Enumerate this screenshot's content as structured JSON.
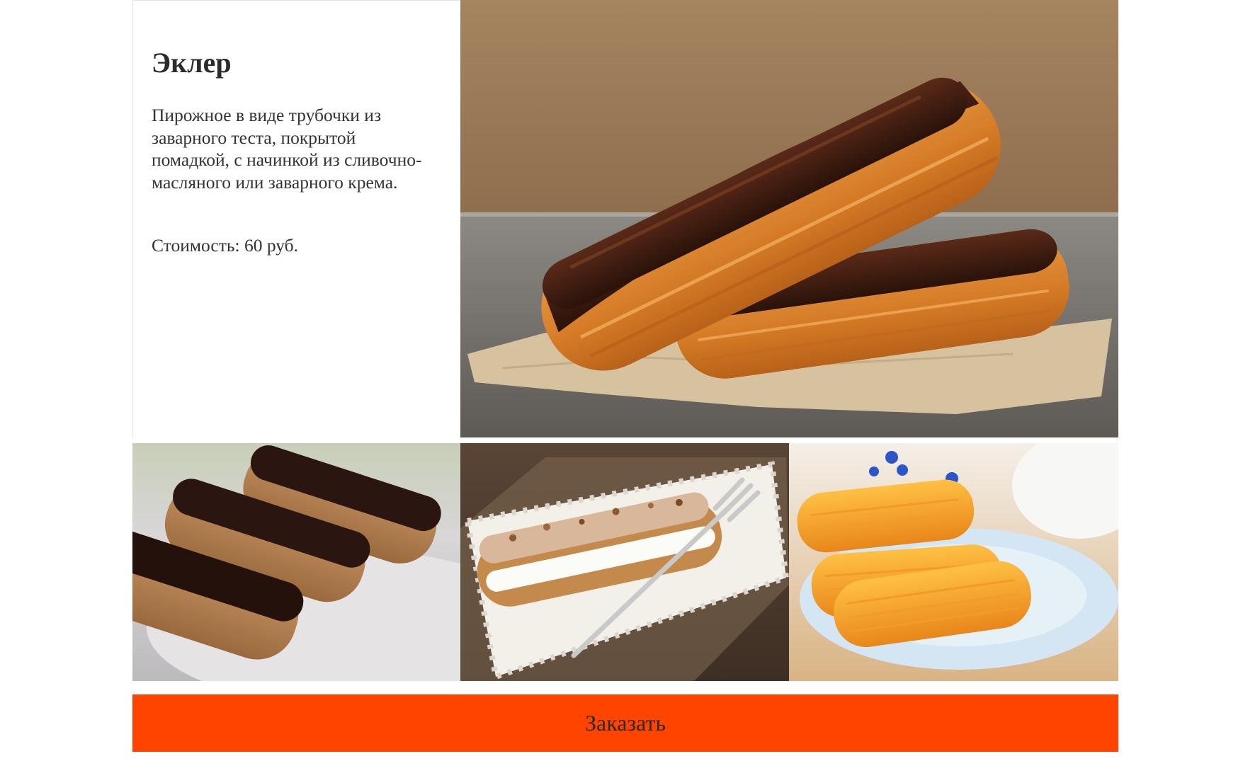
{
  "product": {
    "title": "Эклер",
    "description": "Пирожное в виде трубочки из заварного теста, покрытой помадкой, с начинкой из сливочно-масляного или заварного крема.",
    "price": "Стоимость: 60 руб."
  },
  "actions": {
    "order_label": "Заказать"
  },
  "colors": {
    "accent": "#ff4400",
    "text": "#2b2b2b",
    "background": "#ffffff"
  }
}
